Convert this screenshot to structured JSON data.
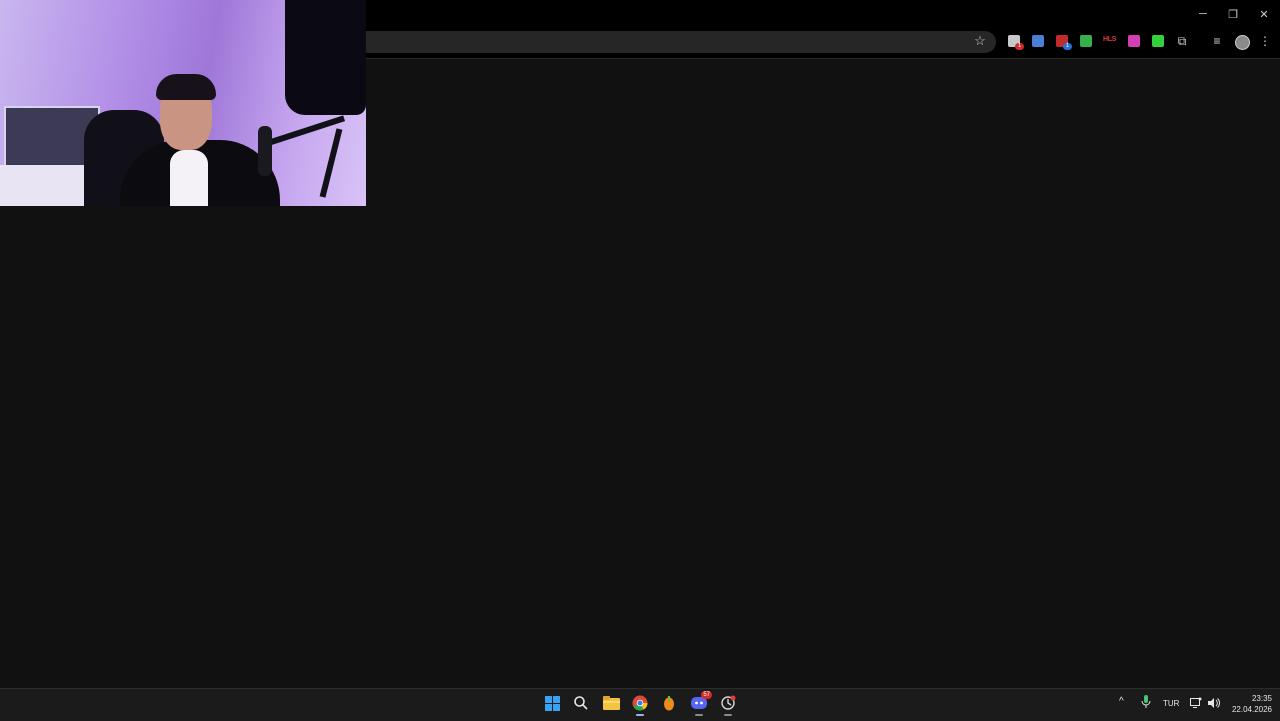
{
  "window": {
    "minimize_glyph": "─",
    "restore_glyph": "❐",
    "close_glyph": "✕"
  },
  "toolbar": {
    "bookmark_glyph": "☆",
    "extensions": [
      {
        "name": "extension-1",
        "color": "#c8c8c8",
        "badge": "1"
      },
      {
        "name": "translate-extension",
        "color": "#4a7fd6"
      },
      {
        "name": "extension-3",
        "color": "#c22b2b",
        "badge": "1"
      },
      {
        "name": "download-extension",
        "color": "#36b24a"
      },
      {
        "name": "hls-extension",
        "label": "HLS",
        "color": "#e03a3a"
      },
      {
        "name": "extension-6",
        "color": "#d43fb3"
      },
      {
        "name": "extension-7",
        "color": "#33d13d"
      }
    ],
    "puzzle_glyph": "⧉",
    "media_glyph": "≡",
    "menu_glyph": "⋮"
  },
  "taskbar": {
    "apps": [
      "start-icon",
      "search-icon",
      "file-explorer-icon",
      "chrome-icon",
      "fl-studio-icon",
      "discord-icon",
      "app-icon"
    ],
    "discord_badge": "57",
    "tray": {
      "chevron": "^",
      "language": "TUR"
    },
    "clock": {
      "time": "23:35",
      "date": "22.04.2026"
    }
  },
  "colors": {
    "accent": "#3aa0f3",
    "background": "#111111",
    "chrome": "#000000"
  }
}
